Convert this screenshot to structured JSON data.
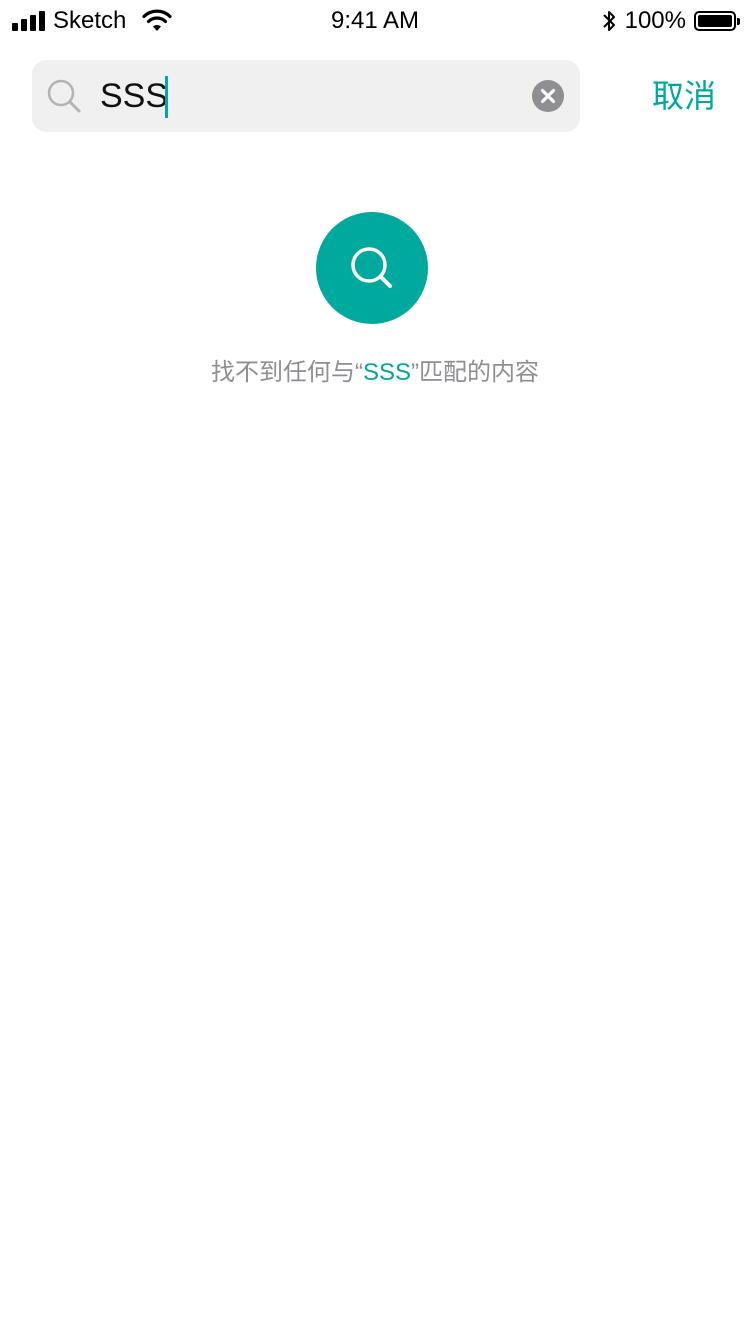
{
  "status_bar": {
    "carrier": "Sketch",
    "time": "9:41 AM",
    "battery_percent": "100%",
    "icons": [
      "signal-icon",
      "wifi-icon",
      "bluetooth-icon",
      "battery-icon"
    ]
  },
  "search": {
    "value": "SSS",
    "placeholder": "",
    "cancel_label": "取消"
  },
  "empty_state": {
    "prefix": "找不到任何与“",
    "keyword": "SSS",
    "suffix": "”匹配的内容"
  },
  "colors": {
    "accent": "#00a99d",
    "muted_text": "#8e8e93",
    "search_bg": "#f0f0f0"
  }
}
